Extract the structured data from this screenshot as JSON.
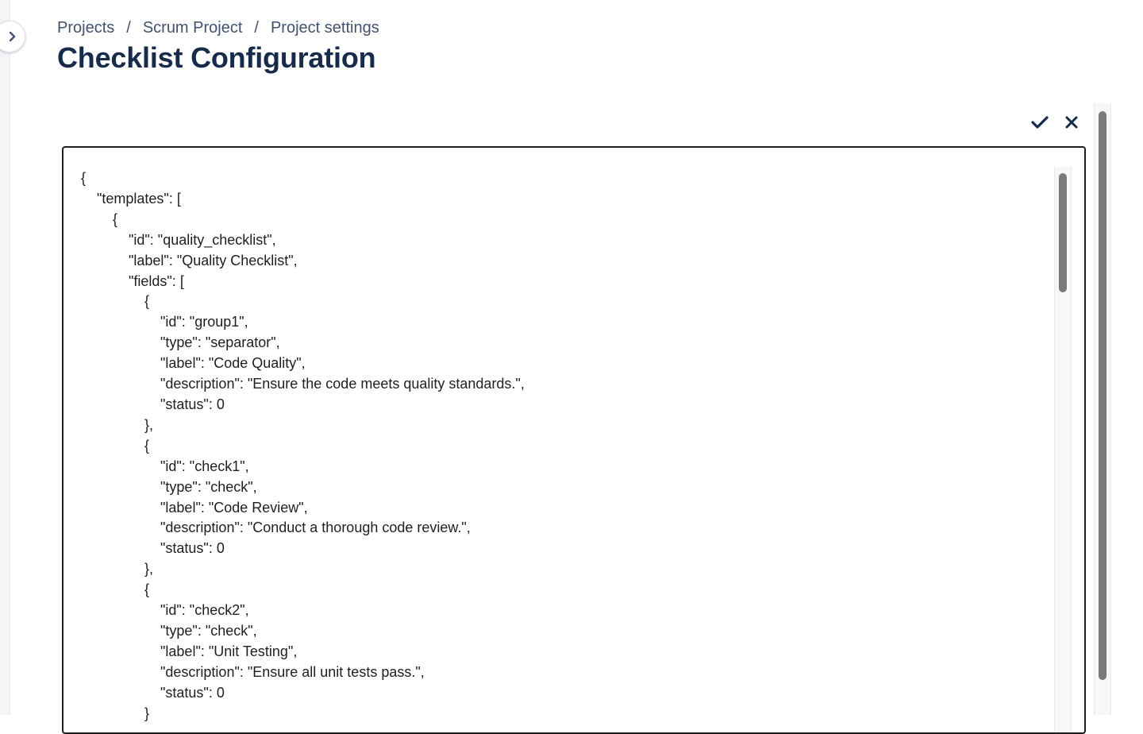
{
  "breadcrumbs": {
    "items": [
      "Projects",
      "Scrum Project",
      "Project settings"
    ],
    "separator": "/"
  },
  "page": {
    "title": "Checklist Configuration"
  },
  "actions": {
    "confirm_icon": "check-icon",
    "cancel_icon": "close-icon"
  },
  "sidebar": {
    "toggle_icon": "chevron-right-icon"
  },
  "editor": {
    "lines": [
      "{",
      "    \"templates\": [",
      "        {",
      "            \"id\": \"quality_checklist\",",
      "            \"label\": \"Quality Checklist\",",
      "            \"fields\": [",
      "                {",
      "                    \"id\": \"group1\",",
      "                    \"type\": \"separator\",",
      "                    \"label\": \"Code Quality\",",
      "                    \"description\": \"Ensure the code meets quality standards.\",",
      "                    \"status\": 0",
      "                },",
      "                {",
      "                    \"id\": \"check1\",",
      "                    \"type\": \"check\",",
      "                    \"label\": \"Code Review\",",
      "                    \"description\": \"Conduct a thorough code review.\",",
      "                    \"status\": 0",
      "                },",
      "                {",
      "                    \"id\": \"check2\",",
      "                    \"type\": \"check\",",
      "                    \"label\": \"Unit Testing\",",
      "                    \"description\": \"Ensure all unit tests pass.\",",
      "                    \"status\": 0",
      "                }"
    ]
  },
  "colors": {
    "text": "#172b4d",
    "breadcrumb": "#42526e",
    "border": "#1f1f1f",
    "scrollbar": "#7a7a7a"
  }
}
